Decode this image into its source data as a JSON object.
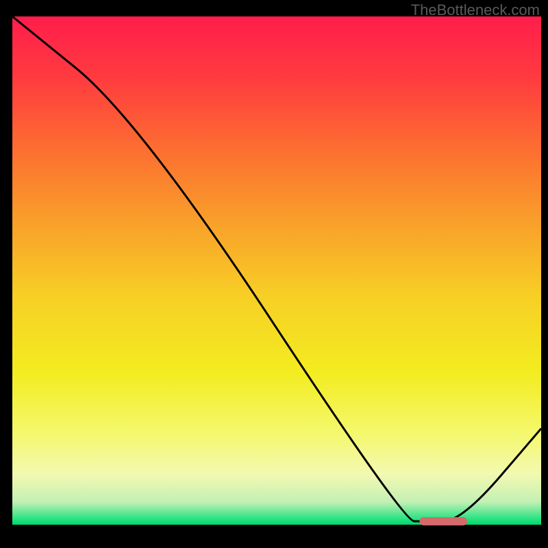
{
  "watermark": "TheBottleneck.com",
  "chart_data": {
    "type": "line",
    "title": "",
    "xlabel": "",
    "ylabel": "",
    "xlim": [
      0,
      100
    ],
    "ylim": [
      0,
      100
    ],
    "series": [
      {
        "name": "curve",
        "x": [
          0,
          24,
          74,
          78,
          85,
          100
        ],
        "values": [
          100,
          80,
          2,
          2,
          2,
          20
        ]
      }
    ],
    "marker": {
      "x_start": 77,
      "x_end": 86,
      "y": 2,
      "color": "#d46a6a"
    },
    "gradient_stops": [
      {
        "offset": 0.0,
        "color": "#ff1d4b"
      },
      {
        "offset": 0.12,
        "color": "#ff3b3f"
      },
      {
        "offset": 0.25,
        "color": "#fd6a32"
      },
      {
        "offset": 0.4,
        "color": "#f99e2a"
      },
      {
        "offset": 0.55,
        "color": "#f7cf25"
      },
      {
        "offset": 0.7,
        "color": "#f3ec20"
      },
      {
        "offset": 0.82,
        "color": "#f4f86d"
      },
      {
        "offset": 0.9,
        "color": "#f3f9b0"
      },
      {
        "offset": 0.955,
        "color": "#c3f0b5"
      },
      {
        "offset": 0.99,
        "color": "#22e27e"
      },
      {
        "offset": 1.0,
        "color": "#00d76a"
      }
    ]
  }
}
